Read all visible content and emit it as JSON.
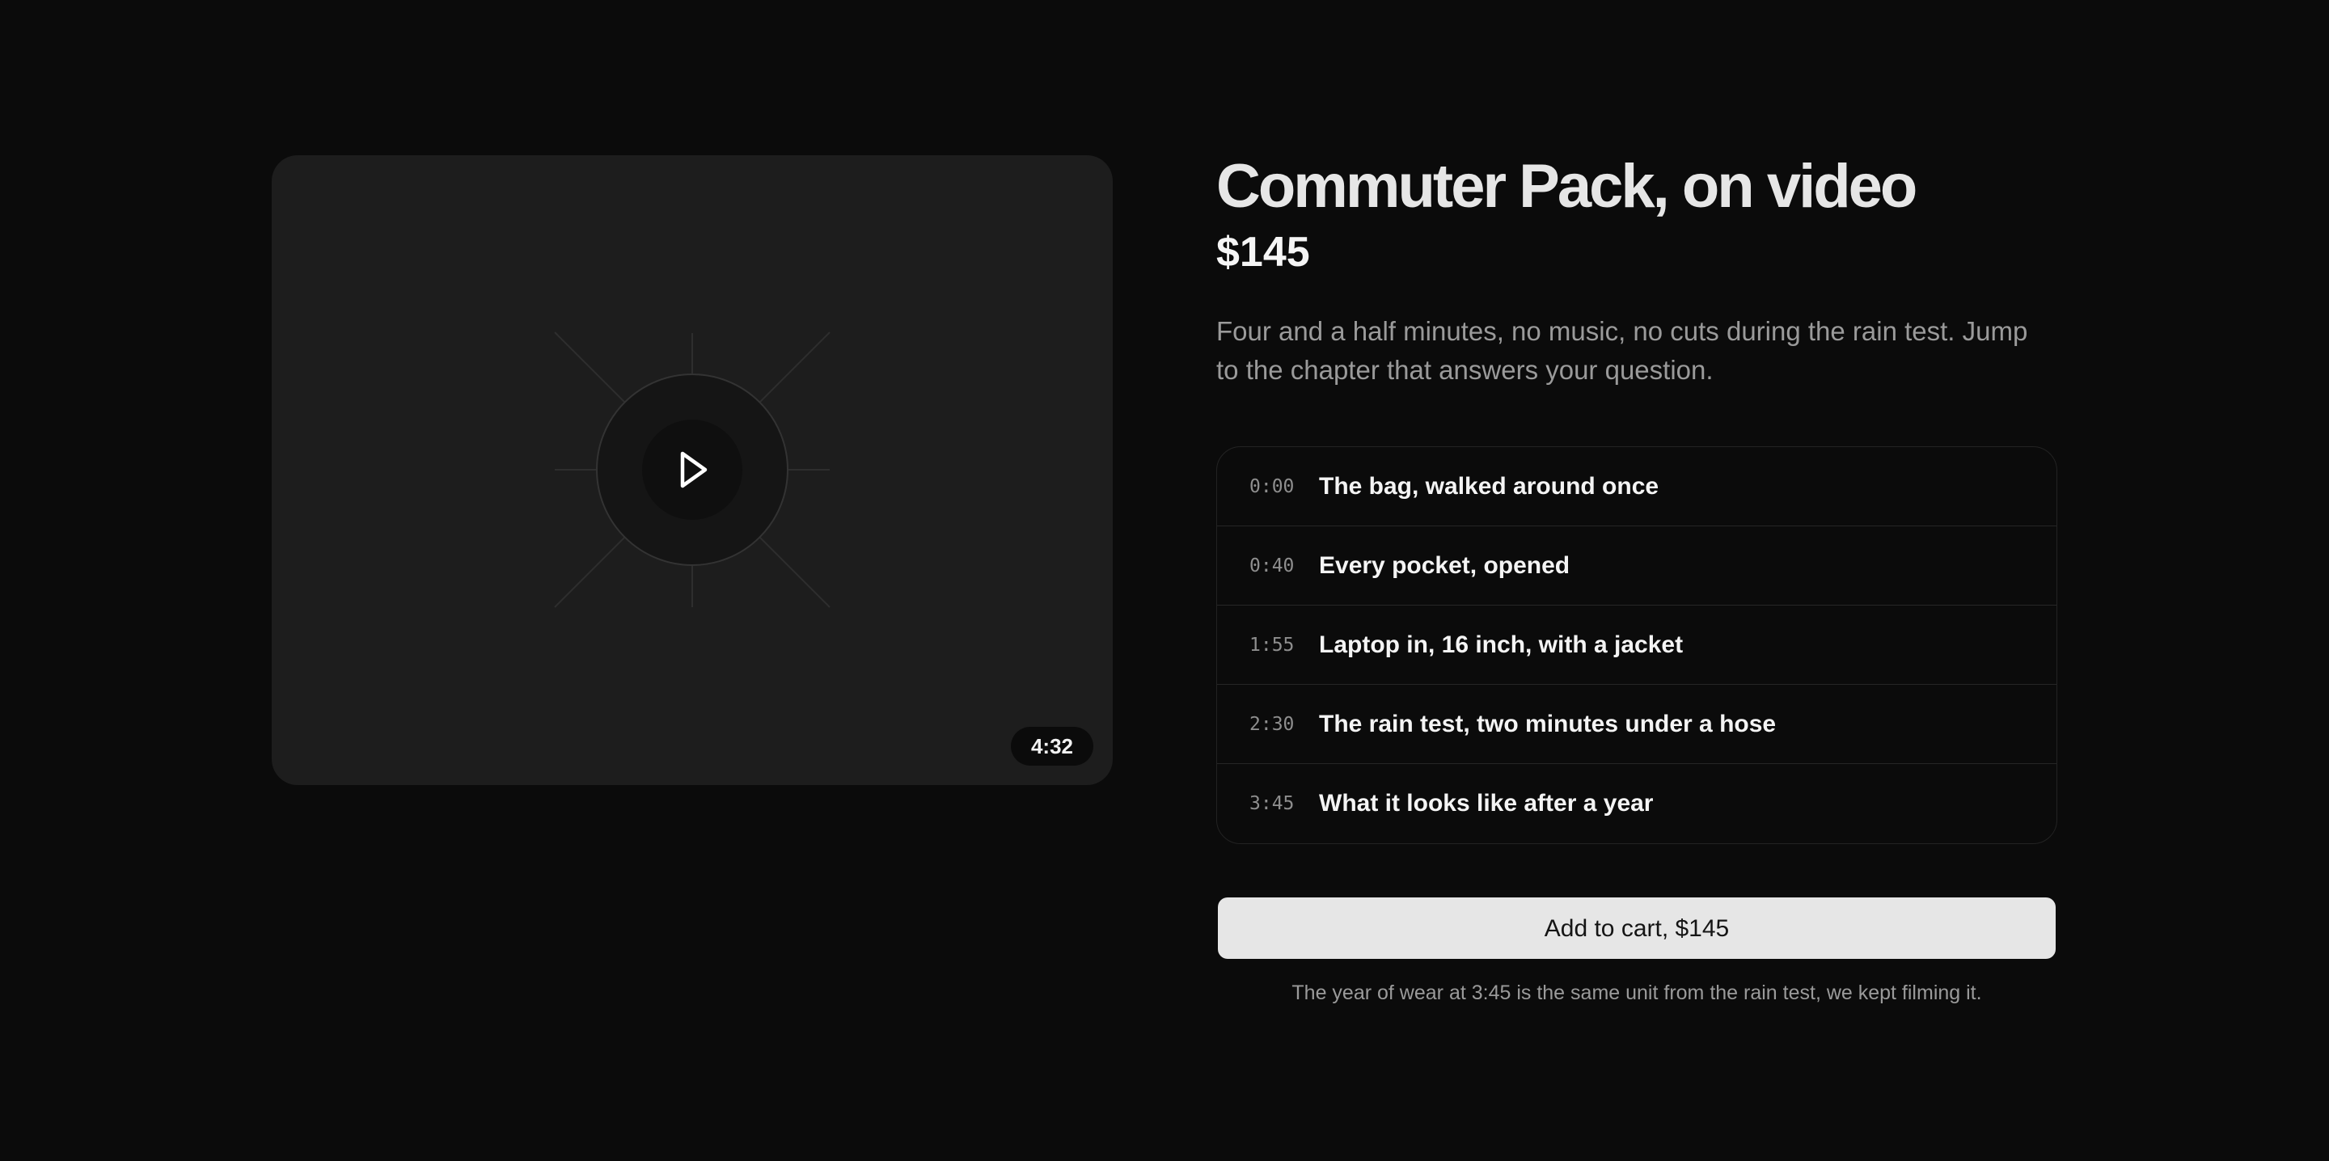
{
  "product": {
    "title": "Commuter Pack, on video",
    "price": "$145",
    "description": "Four and a half minutes, no music, no cuts during the rain test. Jump to the chapter that answers your question."
  },
  "video": {
    "duration": "4:32",
    "play_icon": "play-icon"
  },
  "chapters": [
    {
      "time": "0:00",
      "title": "The bag, walked around once"
    },
    {
      "time": "0:40",
      "title": "Every pocket, opened"
    },
    {
      "time": "1:55",
      "title": "Laptop in, 16 inch, with a jacket"
    },
    {
      "time": "2:30",
      "title": "The rain test, two minutes under a hose"
    },
    {
      "time": "3:45",
      "title": "What it looks like after a year"
    }
  ],
  "cart": {
    "label": "Add to cart, $145"
  },
  "note": "The year of wear at 3:45 is the same unit from the rain test, we kept filming it.",
  "colors": {
    "background": "#0b0b0b",
    "video_surface": "#1d1d1d",
    "cart_button": "#e6e6e6"
  }
}
